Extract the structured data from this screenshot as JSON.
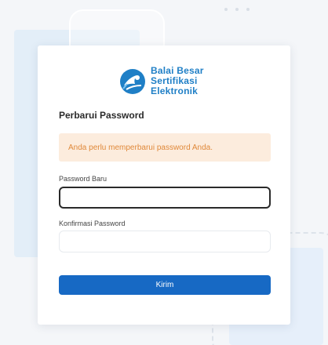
{
  "brand": {
    "logo_line1": "Balai Besar",
    "logo_line2": "Sertifikasi",
    "logo_line3": "Elektronik",
    "accent_color": "#1f7fc6"
  },
  "form": {
    "title": "Perbarui Password",
    "alert_message": "Anda perlu memperbarui password Anda.",
    "new_password_label": "Password Baru",
    "new_password_value": "",
    "confirm_password_label": "Konfirmasi Password",
    "confirm_password_value": "",
    "submit_label": "Kirim",
    "submit_color": "#1769c4"
  },
  "icons": {
    "logo": "bbse-logo-icon"
  }
}
